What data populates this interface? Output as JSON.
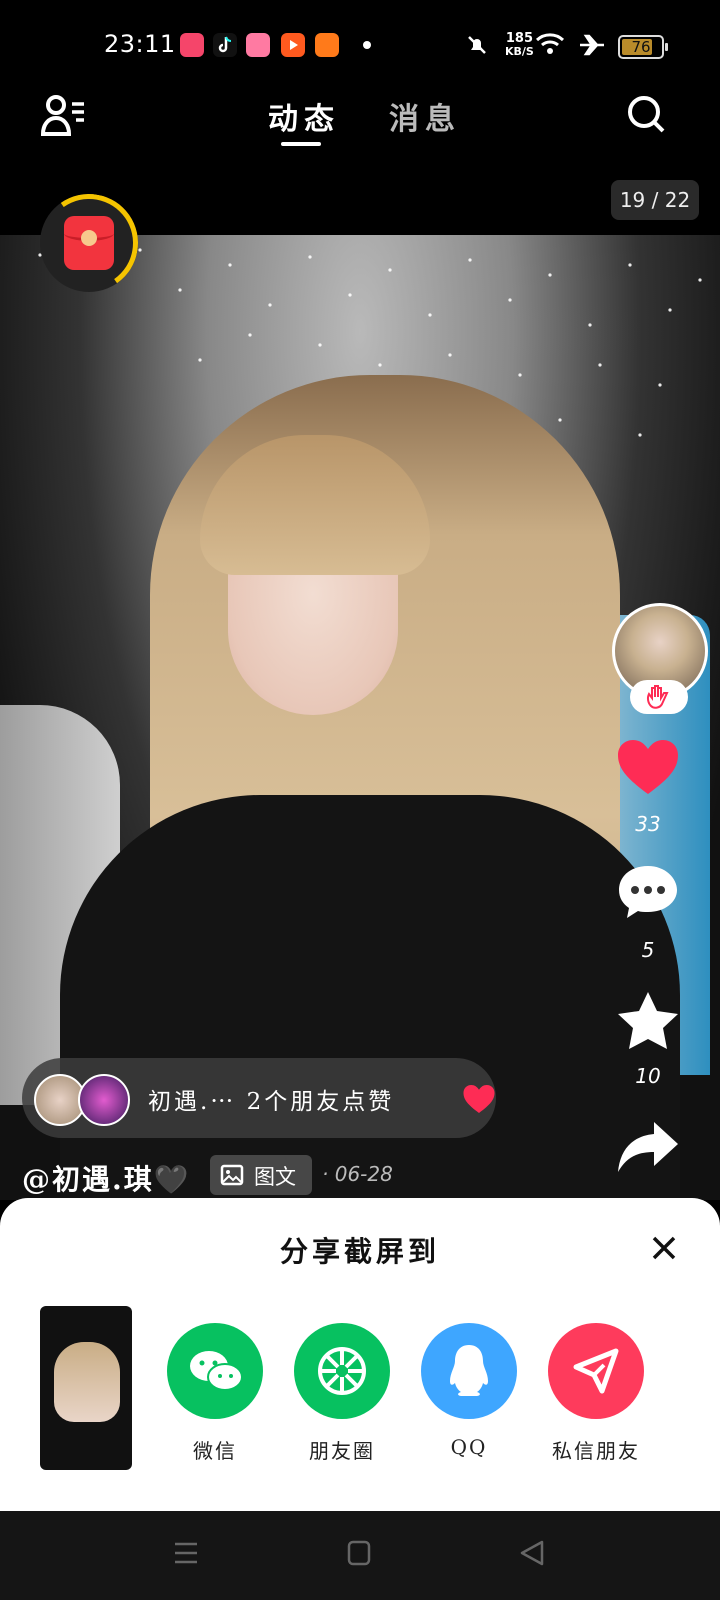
{
  "status_bar": {
    "time": "23:11",
    "network_speed_value": "185",
    "network_speed_unit": "KB/S",
    "battery_level": "76",
    "app_icons": [
      "music-app-icon",
      "tiktok-icon",
      "bilibili-icon",
      "video-app-icon",
      "store-app-icon"
    ]
  },
  "header": {
    "tab_active": "动态",
    "tab_inactive": "消息"
  },
  "post": {
    "image_counter": "19 / 22",
    "author": "@初遇.琪🖤",
    "type_tag": "图文",
    "date": "· 06-28"
  },
  "actions": {
    "likes": "33",
    "comments": "5",
    "favorites": "10"
  },
  "friends_bar": {
    "text": "初遇.⋯  2个朋友点赞"
  },
  "share_sheet": {
    "title": "分享截屏到",
    "targets": [
      {
        "label": "微信",
        "color": "#07c160",
        "icon": "wechat-icon"
      },
      {
        "label": "朋友圈",
        "color": "#07c160",
        "icon": "moments-icon"
      },
      {
        "label": "QQ",
        "color": "#3ea6ff",
        "icon": "qq-icon"
      },
      {
        "label": "私信朋友",
        "color": "#fe3b5c",
        "icon": "send-icon"
      }
    ]
  },
  "colors": {
    "like_red": "#fe2c55",
    "accent_yellow": "#f5c400"
  }
}
